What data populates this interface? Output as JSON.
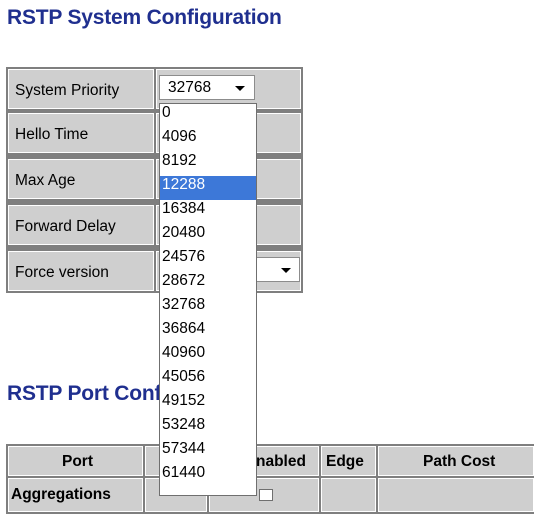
{
  "system_config": {
    "title": "RSTP System Configuration",
    "rows": [
      {
        "label": "System Priority"
      },
      {
        "label": "Hello Time"
      },
      {
        "label": "Max Age"
      },
      {
        "label": "Forward Delay"
      },
      {
        "label": "Force version"
      }
    ],
    "system_priority": {
      "selected_value": "32768",
      "options": [
        "0",
        "4096",
        "8192",
        "12288",
        "16384",
        "20480",
        "24576",
        "28672",
        "32768",
        "36864",
        "40960",
        "45056",
        "49152",
        "53248",
        "57344",
        "61440"
      ],
      "highlighted_option": "12288"
    },
    "force_version": {
      "selected_value": ""
    }
  },
  "port_config": {
    "title": "RSTP Port Configuration",
    "columns": [
      "Port",
      "P",
      "Enabled",
      "Edge",
      "Path Cost"
    ],
    "header_visible": [
      "Port",
      "P",
      "nabled",
      "Edge",
      "Path Cost"
    ],
    "rows": [
      {
        "port": "Aggregations"
      }
    ]
  },
  "colors": {
    "heading": "#1f2f8f",
    "cell_bg": "#cfcfcf",
    "grid": "#7f7f7f",
    "selection": "#3d78d8"
  }
}
